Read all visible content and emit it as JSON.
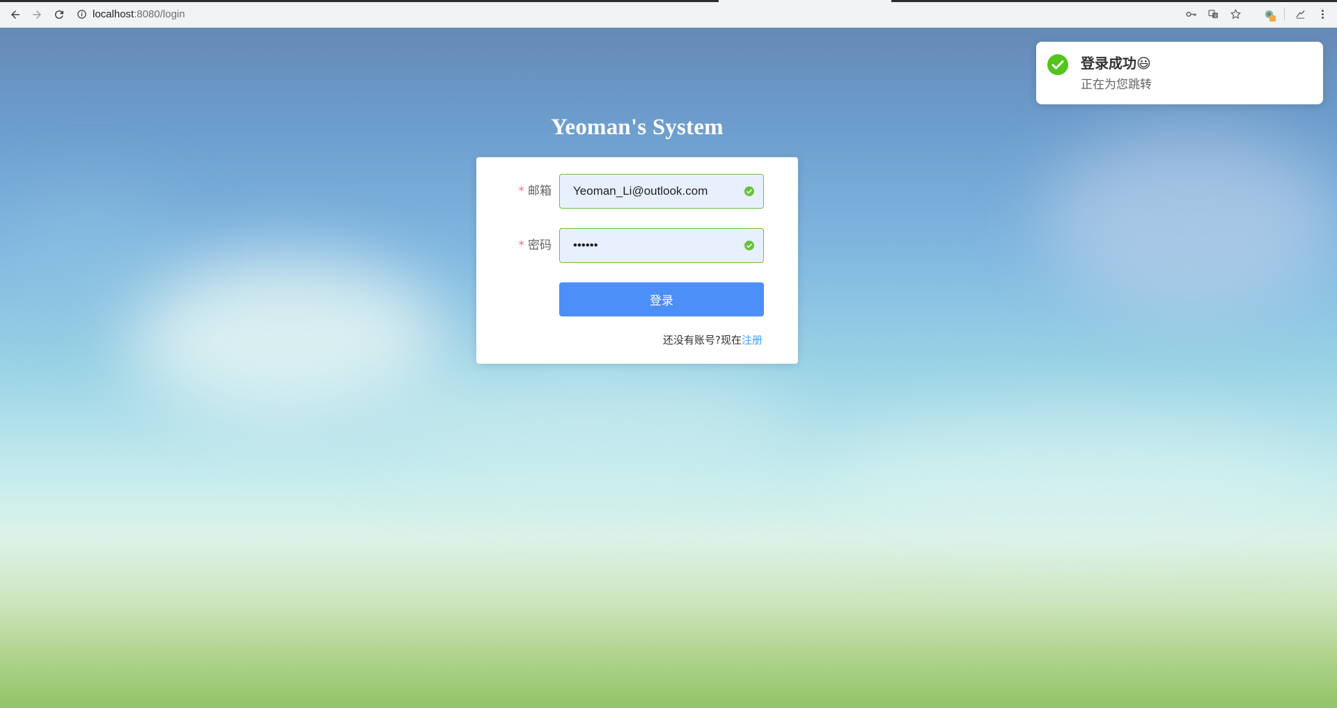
{
  "browser": {
    "url_host": "localhost",
    "url_path": ":8080/login",
    "icons": [
      "back-arrow-icon",
      "forward-arrow-icon",
      "reload-icon",
      "info-icon",
      "key-icon",
      "translate-icon",
      "star-icon",
      "extension-icon",
      "tools-icon",
      "menu-icon"
    ]
  },
  "page": {
    "title": "Yeoman's System"
  },
  "form": {
    "required_mark": "*",
    "email_label": "邮箱",
    "email_value": "Yeoman_Li@outlook.com",
    "password_label": "密码",
    "password_value": "••••••",
    "submit_label": "登录",
    "register_prompt": "还没有账号?现在",
    "register_link": "注册"
  },
  "notification": {
    "title": "登录成功😃",
    "message": "正在为您跳转"
  },
  "colors": {
    "success": "#67c23a",
    "primary_button": "#4c8ff9",
    "link": "#409eff",
    "required": "#f56c6c"
  }
}
